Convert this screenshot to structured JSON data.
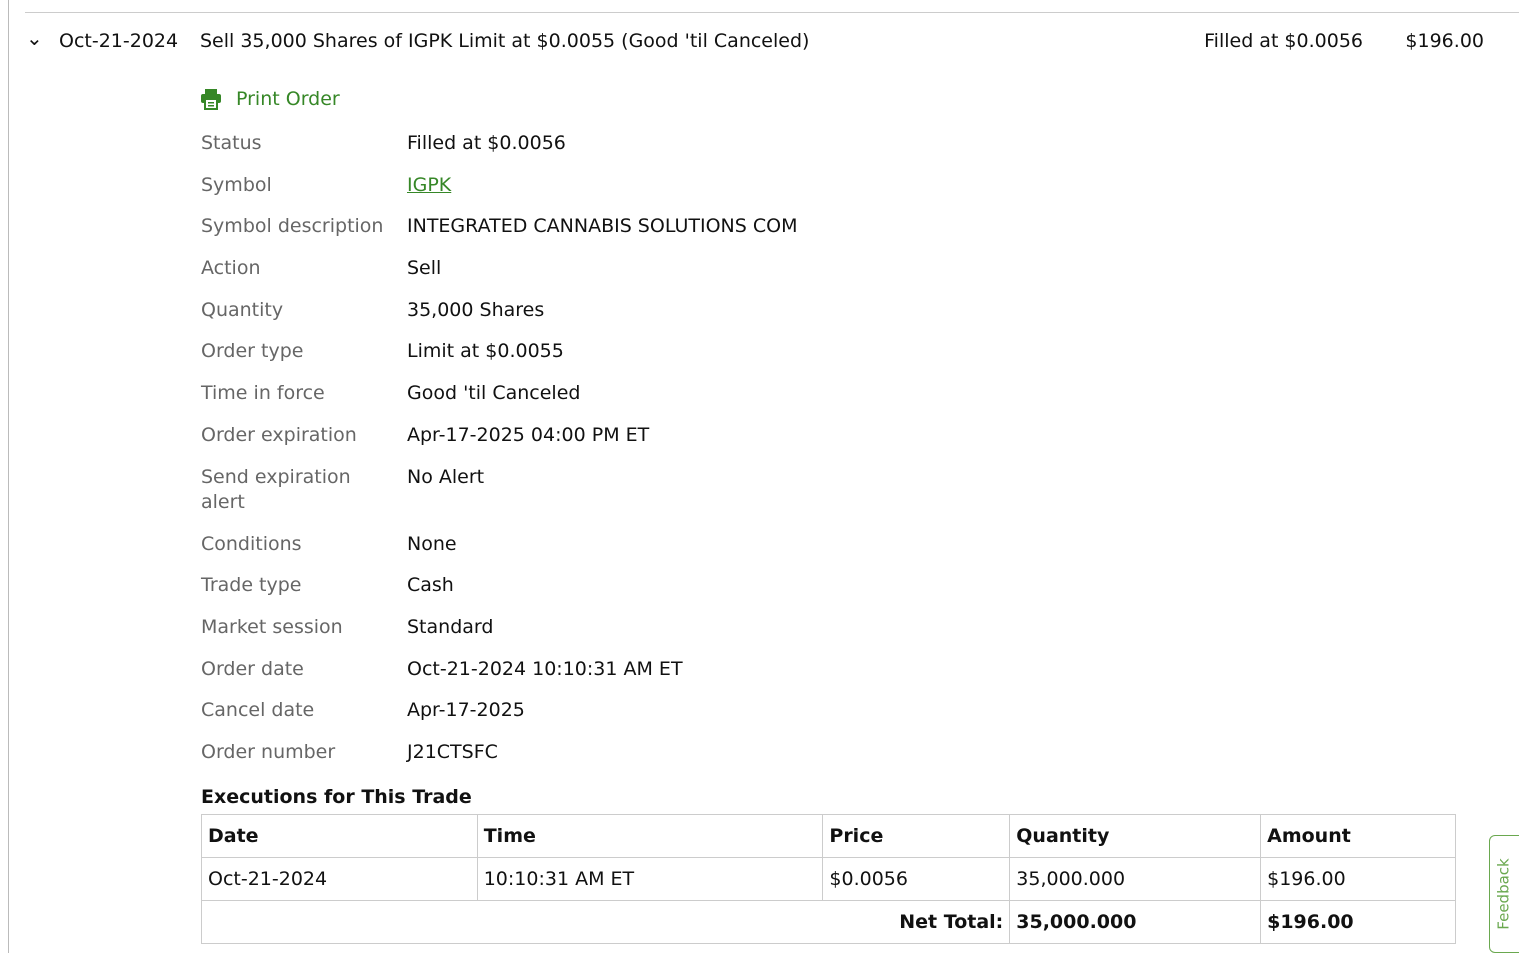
{
  "order": {
    "date": "Oct-21-2024",
    "description": "Sell 35,000 Shares of IGPK Limit at $0.0055 (Good 'til Canceled)",
    "status": "Filled at $0.0056",
    "amount": "$196.00"
  },
  "print_label": "Print Order",
  "details": [
    {
      "label": "Status",
      "value": "Filled at $0.0056"
    },
    {
      "label": "Symbol",
      "value": "IGPK",
      "link": true
    },
    {
      "label": "Symbol description",
      "value": "INTEGRATED CANNABIS SOLUTIONS COM"
    },
    {
      "label": "Action",
      "value": "Sell"
    },
    {
      "label": "Quantity",
      "value": "35,000 Shares"
    },
    {
      "label": "Order type",
      "value": "Limit at $0.0055"
    },
    {
      "label": "Time in force",
      "value": "Good 'til Canceled"
    },
    {
      "label": "Order expiration",
      "value": "Apr-17-2025 04:00 PM ET"
    },
    {
      "label": "Send expiration alert",
      "value": "No Alert"
    },
    {
      "label": "Conditions",
      "value": "None"
    },
    {
      "label": "Trade type",
      "value": "Cash"
    },
    {
      "label": "Market session",
      "value": "Standard"
    },
    {
      "label": "Order date",
      "value": "Oct-21-2024 10:10:31 AM ET"
    },
    {
      "label": "Cancel date",
      "value": "Apr-17-2025"
    },
    {
      "label": "Order number",
      "value": "J21CTSFC"
    }
  ],
  "executions": {
    "title": "Executions for This Trade",
    "headers": [
      "Date",
      "Time",
      "Price",
      "Quantity",
      "Amount"
    ],
    "rows": [
      [
        "Oct-21-2024",
        "10:10:31 AM ET",
        "$0.0056",
        "35,000.000",
        "$196.00"
      ]
    ],
    "net_label": "Net Total:",
    "net_quantity": "35,000.000",
    "net_amount": "$196.00"
  },
  "feedback": "Feedback"
}
